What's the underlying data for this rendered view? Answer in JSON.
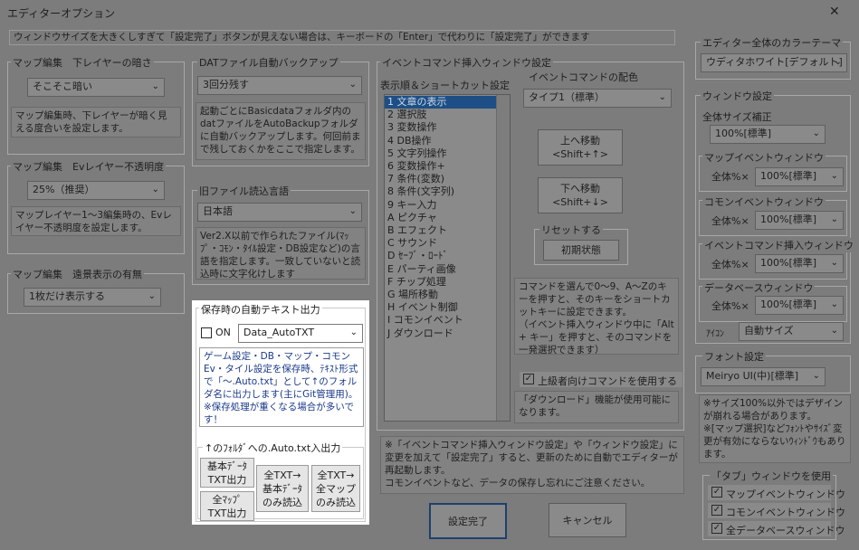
{
  "window": {
    "title": "エディターオプション",
    "close_label": "✕"
  },
  "info_bar": "ウィンドウサイズを大きくしすぎて「設定完了」ボタンが見えない場合は、キーボードの「Enter」で代わりに「設定完了」ができます",
  "map_layer_dark": {
    "title": "マップ編集　下レイヤーの暗さ",
    "value": "そこそこ暗い",
    "desc": "マップ編集時、下レイヤーが暗く見える度合いを設定します。"
  },
  "ev_layer_opacity": {
    "title": "マップ編集　Evレイヤー不透明度",
    "value": "25%（推奨）",
    "desc": "マップレイヤー1～3編集時の、Evレイヤー不透明度を設定します。"
  },
  "far_view": {
    "title": "マップ編集　遠景表示の有無",
    "value": "1枚だけ表示する"
  },
  "dat_backup": {
    "title": "DATファイル自動バックアップ",
    "value": "3回分残す",
    "desc": "起動ごとにBasicdataフォルダ内のdatファイルをAutoBackupフォルダに自動バックアップします。何回前まで残しておくかをここで指定します。"
  },
  "old_file_lang": {
    "title": "旧ファイル読込言語",
    "value": "日本語",
    "desc": "Ver2.X以前で作られたファイル(ﾏｯﾌﾟ・ｺﾓﾝ・ﾀｲﾙ設定・DB設定など)の言語を指定します。一致していないと読込時に文字化けします"
  },
  "auto_text": {
    "title": "保存時の自動テキスト出力",
    "on_label": "ON",
    "folder_value": "Data_AutoTXT",
    "desc": "ゲーム設定・DB・マップ・コモンEv・タイル設定を保存時、ﾃｷｽﾄ形式で「～.Auto.txt」として↑のフォルダ名に出力します(主にGit管理用)。※保存処理が重くなる場合が多いです！",
    "subgroup_title": "↑のﾌｫﾙﾀﾞへの.Auto.txt入出力",
    "btn_basic_out": "基本ﾃﾞｰﾀ\nTXT出力",
    "btn_map_out": "全ﾏｯﾌﾟ\nTXT出力",
    "btn_all_basic_in": "全TXT→\n基本ﾃﾞｰﾀ\nのみ読込",
    "btn_all_map_in": "全TXT→\n全マップ\nのみ読込"
  },
  "event_cmd": {
    "title": "イベントコマンド挿入ウィンドウ設定",
    "list_title": "表示順＆ショートカット設定",
    "items": [
      "1 文章の表示",
      "2 選択肢",
      "3 変数操作",
      "4 DB操作",
      "5 文字列操作",
      "6 変数操作+",
      "7 条件(変数)",
      "8 条件(文字列)",
      "9 キー入力",
      "A ピクチャ",
      "B エフェクト",
      "C サウンド",
      "D ｾｰﾌﾞ・ﾛｰﾄﾞ",
      "E パーティ画像",
      "F チップ処理",
      "G 場所移動",
      "H イベント制御",
      "I コモンイベント",
      "J ダウンロード"
    ],
    "color_title": "イベントコマンドの配色",
    "color_value": "タイプ1（標準）",
    "up_label": "上へ移動\n<Shift+↑>",
    "down_label": "下へ移動\n<Shift+↓>",
    "reset_title": "リセットする",
    "reset_label": "初期状態",
    "shortcut_desc": "コマンドを選んで0～9、A～Zのキーを押すと、そのキーをショートカットキーに設定できます。\n（イベント挿入ウィンドウ中に「Alt + キー」を押すと、そのコマンドを一発選択できます）",
    "advanced_label": "上級者向けコマンドを使用する",
    "advanced_desc": "「ダウンロード」機能が使用可能になります。"
  },
  "restart_note": "※「イベントコマンド挿入ウィンドウ設定」や「ウィンドウ設定」に変更を加えて「設定完了」すると、更新のために自動でエディターが再起動します。\n  コモンイベントなど、データの保存し忘れにご注意ください。",
  "buttons": {
    "ok": "設定完了",
    "cancel": "キャンセル"
  },
  "theme": {
    "title": "エディター全体のカラーテーマ",
    "value": "ウディタホワイト[デフォルト]"
  },
  "window_settings": {
    "title": "ウィンドウ設定",
    "overall_label": "全体サイズ補正",
    "overall_value": "100%[標準]",
    "map_event": {
      "title": "マップイベントウィンドウ",
      "label": "全体%×",
      "value": "100%[標準]"
    },
    "common_event": {
      "title": "コモンイベントウィンドウ",
      "label": "全体%×",
      "value": "100%[標準]"
    },
    "cmd_insert": {
      "title": "イベントコマンド挿入ウィンドウ",
      "label": "全体%×",
      "value": "100%[標準]"
    },
    "database": {
      "title": "データベースウィンドウ",
      "label": "全体%×",
      "value": "100%[標準]"
    },
    "icon_label": "ｱｲｺﾝ",
    "icon_value": "自動サイズ"
  },
  "font": {
    "title": "フォント設定",
    "value": "Meiryo UI(中)[標準]",
    "desc": "※サイズ100%以外ではデザインが崩れる場合があります。\n※[マップ選択]などﾌｫﾝﾄやｻｲｽﾞ変更が有効にならないｳｨﾝﾄﾞｳもあります。"
  },
  "tabs": {
    "title": "「タブ」ウィンドウを使用",
    "items": [
      "マップイベントウィンドウ",
      "コモンイベントウィンドウ",
      "全データベースウィンドウ"
    ]
  }
}
